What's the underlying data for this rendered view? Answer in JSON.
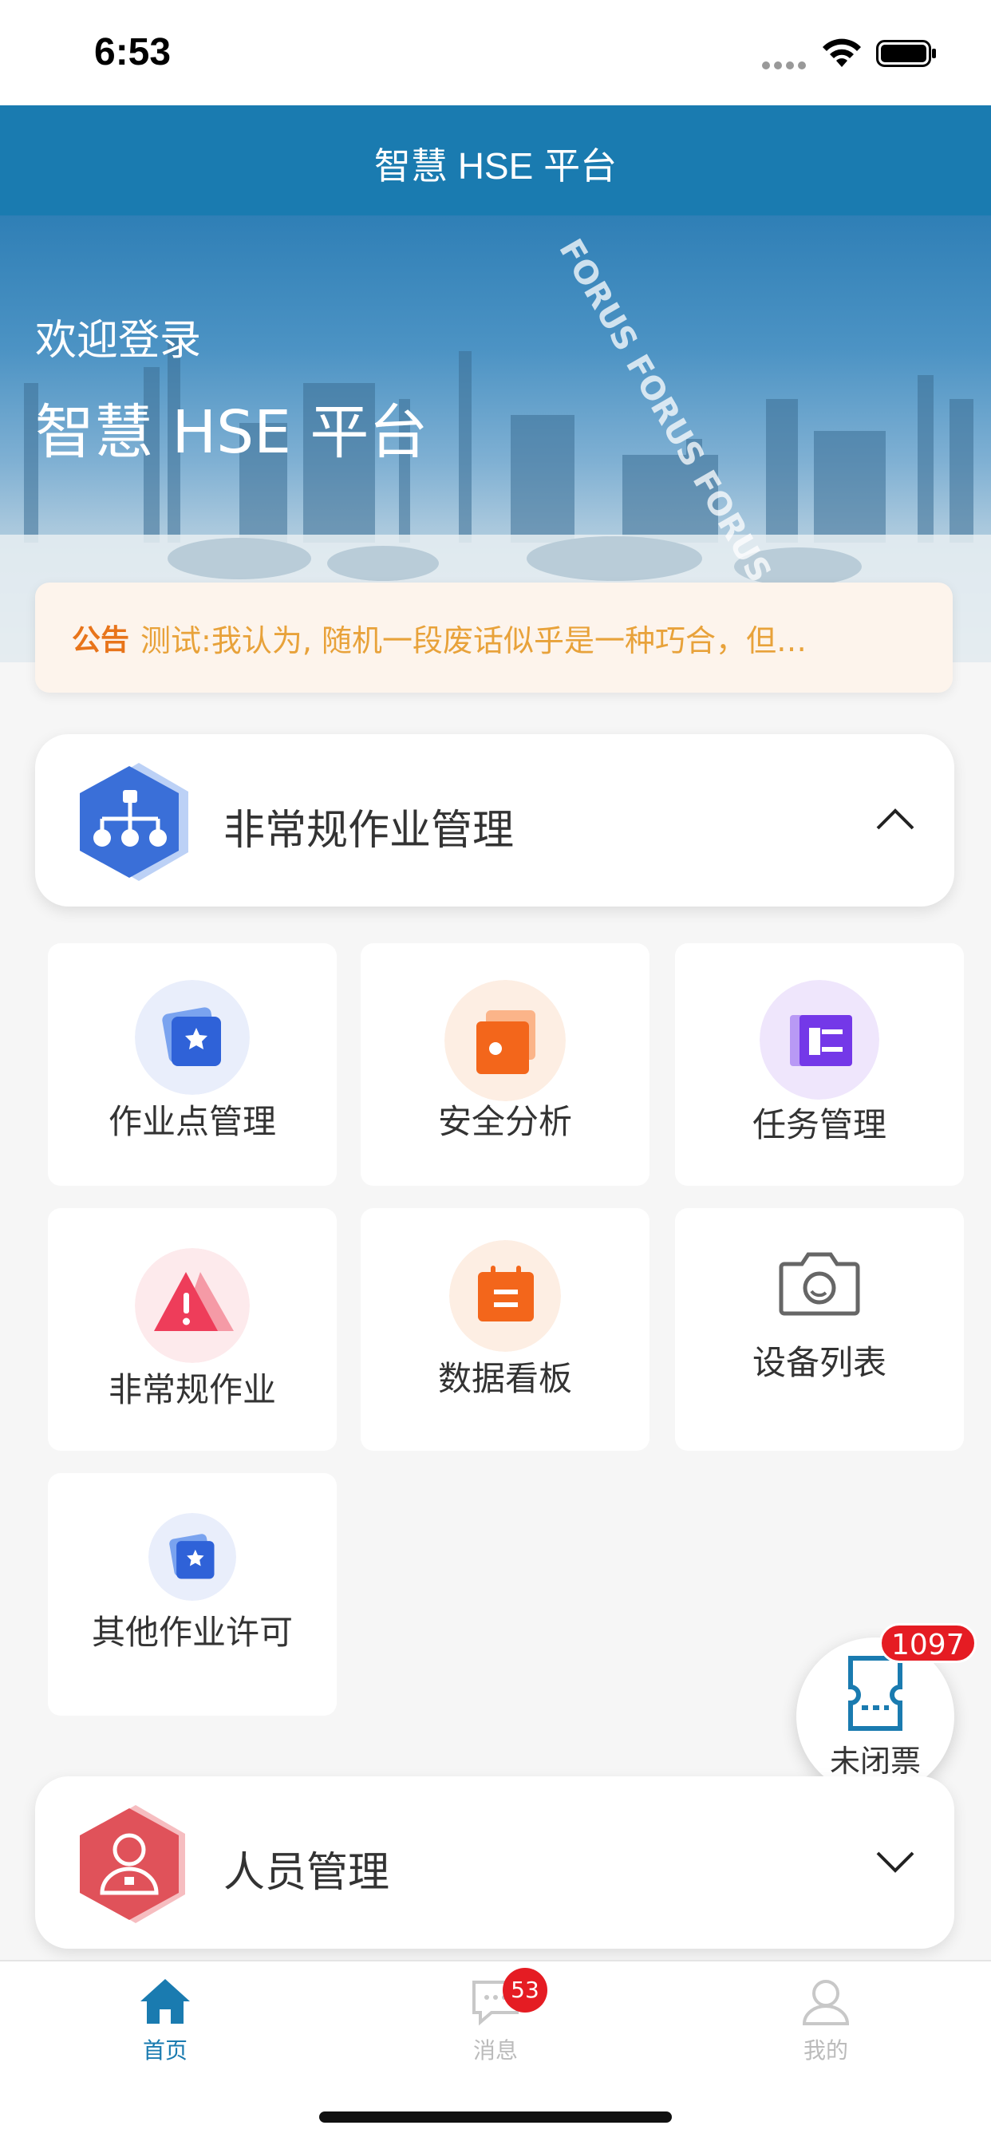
{
  "status_bar": {
    "time": "6:53"
  },
  "header": {
    "title": "智慧 HSE 平台"
  },
  "banner": {
    "welcome": "欢迎登录",
    "title": "智慧 HSE 平台",
    "watermark": "FORUS FORUS FORUS"
  },
  "notice": {
    "tag": "公告",
    "text": "测试:我认为, 随机一段废话似乎是一种巧合，但…"
  },
  "sections": [
    {
      "title": "非常规作业管理",
      "expanded": true,
      "icon": "org-chart-icon",
      "color": "#3a6fd8"
    },
    {
      "title": "人员管理",
      "expanded": false,
      "icon": "person-icon",
      "color": "#e0525a"
    }
  ],
  "tiles": [
    {
      "label": "作业点管理",
      "icon": "card-star-icon"
    },
    {
      "label": "安全分析",
      "icon": "layers-icon"
    },
    {
      "label": "任务管理",
      "icon": "task-icon"
    },
    {
      "label": "非常规作业",
      "icon": "warning-icon"
    },
    {
      "label": "数据看板",
      "icon": "board-icon"
    },
    {
      "label": "设备列表",
      "icon": "camera-icon"
    },
    {
      "label": "其他作业许可",
      "icon": "card-star-icon"
    }
  ],
  "fab": {
    "label": "未闭票",
    "badge": "1097"
  },
  "tabbar": {
    "items": [
      {
        "label": "首页",
        "icon": "home-icon",
        "active": true
      },
      {
        "label": "消息",
        "icon": "message-icon",
        "badge": "53"
      },
      {
        "label": "我的",
        "icon": "user-icon"
      }
    ]
  },
  "colors": {
    "primary": "#1a7bb0",
    "notice": "#e8741a",
    "badge": "#e51c23"
  }
}
